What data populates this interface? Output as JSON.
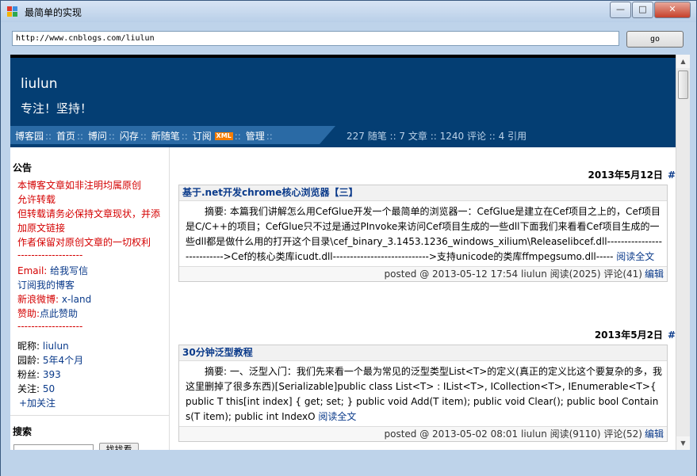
{
  "window": {
    "title": "最简单的实现",
    "minimize": "—",
    "maximize": "□",
    "close": "✕"
  },
  "toolbar": {
    "url": "http://www.cnblogs.com/liulun",
    "go_label": "go"
  },
  "blog": {
    "title": "liulun",
    "subtitle": "专注！坚持！"
  },
  "nav": {
    "items": [
      "博客园",
      "首页",
      "博问",
      "闪存",
      "新随笔",
      "订阅",
      "管理"
    ],
    "xml_badge": "XML",
    "stats": "227 随笔 :: 7 文章 :: 1240 评论 :: 4 引用"
  },
  "sidebar": {
    "notice_heading": "公告",
    "notice_lines": [
      "本博客文章如非注明均属原创",
      "允许转载",
      "但转载请务必保持文章现状，并添",
      "加原文链接",
      "作者保留对原创文章的一切权利",
      "-------------------"
    ],
    "email_label": "Email:",
    "email_value": "给我写信",
    "subscribe": "订阅我的博客",
    "weibo_label": "新浪微博:",
    "weibo_value": "x-land",
    "donate_label": "赞助:",
    "donate_value": "点此赞助",
    "divider2": "-------------------",
    "profile": [
      {
        "label": "昵称:",
        "value": "liulun"
      },
      {
        "label": "园龄:",
        "value": "5年4个月"
      },
      {
        "label": "粉丝:",
        "value": "393"
      },
      {
        "label": "关注:",
        "value": "50"
      }
    ],
    "follow": "+加关注",
    "search_heading": "搜索",
    "search_button": "找找看"
  },
  "posts": [
    {
      "date": "2013年5月12日",
      "hash": "#",
      "title": "基于.net开发chrome核心浏览器【三】",
      "desc": "摘要: 本篇我们讲解怎么用CefGlue开发一个最简单的浏览器一：CefGlue是建立在Cef项目之上的，Cef项目是C/C++的项目；CefGlue只不过是通过PInvoke来访问Cef项目生成的一些dll下面我们来看看Cef项目生成的一些dll都是做什么用的打开这个目录\\cef_binary_3.1453.1236_windows_xilium\\Releaselibcef.dll--------------------------->Cef的核心类库icudt.dll---------------------------->支持unicode的类库ffmpegsumo.dll-----",
      "more": "阅读全文",
      "footer": "posted @ 2013-05-12 17:54 liulun 阅读(2025) 评论(41)",
      "edit": "编辑"
    },
    {
      "date": "2013年5月2日",
      "hash": "#",
      "title": "30分钟泛型教程",
      "desc": "摘要: 一、泛型入门：我们先来看一个最为常见的泛型类型List<T>的定义(真正的定义比这个要复杂的多，我这里删掉了很多东西)[Serializable]public class List<T> : IList<T>, ICollection<T>, IEnumerable<T>{ public T this[int index] { get; set; } public void Add(T item); public void Clear(); public bool Contains(T item); public int IndexO",
      "more": "阅读全文",
      "footer": "posted @ 2013-05-02 08:01 liulun 阅读(9110) 评论(52)",
      "edit": "编辑"
    }
  ],
  "colors": {
    "header_bg": "#043e73",
    "nav_bg": "#2a6aa5",
    "link": "#0a3a8a",
    "notice_red": "#d40000",
    "xml_badge": "#f57d00"
  }
}
